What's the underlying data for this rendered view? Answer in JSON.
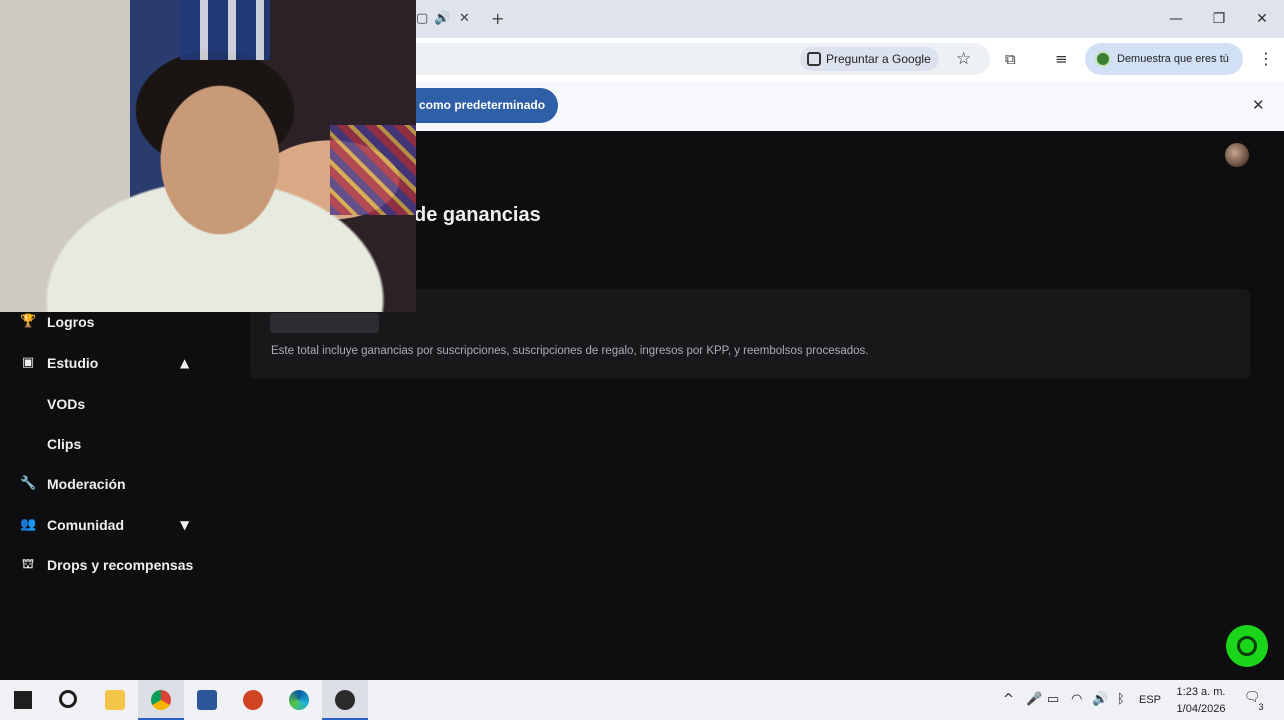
{
  "browser": {
    "tab_controls": {
      "mute_icon": "speaker-icon",
      "close": "✕",
      "new_tab": "+"
    },
    "window_buttons": {
      "minimize": "—",
      "restore": "❐",
      "close": "✕"
    },
    "toolbar": {
      "ask_google_label": "Preguntar a Google",
      "profile_label": "Demuestra que eres tú"
    },
    "infobar": {
      "default_button_label": "como predeterminado",
      "close": "✕"
    }
  },
  "page": {
    "title": "de ganancias",
    "card_note": "Este total incluye ganancias por suscripciones, suscripciones de regalo, ingresos por KPP, y reembolsos procesados."
  },
  "sidebar": {
    "items": [
      {
        "label": "Logros",
        "icon": "trophy-icon"
      },
      {
        "label": "Estudio",
        "icon": "studio-icon",
        "expanded": true
      },
      {
        "label": "VODs",
        "sub": true
      },
      {
        "label": "Clips",
        "sub": true
      },
      {
        "label": "Moderación",
        "icon": "wrench-icon"
      },
      {
        "label": "Comunidad",
        "icon": "community-icon",
        "expanded": false
      },
      {
        "label": "Drops y recompensas",
        "icon": "drops-icon"
      }
    ]
  },
  "taskbar": {
    "lang": "ESP",
    "time": "1:23 a. m.",
    "date": "1/04/2026",
    "notifications": "3"
  },
  "colors": {
    "accent_blue": "#2f5fa7",
    "help_green": "#1bd51b",
    "page_bg": "#0e0e10"
  }
}
